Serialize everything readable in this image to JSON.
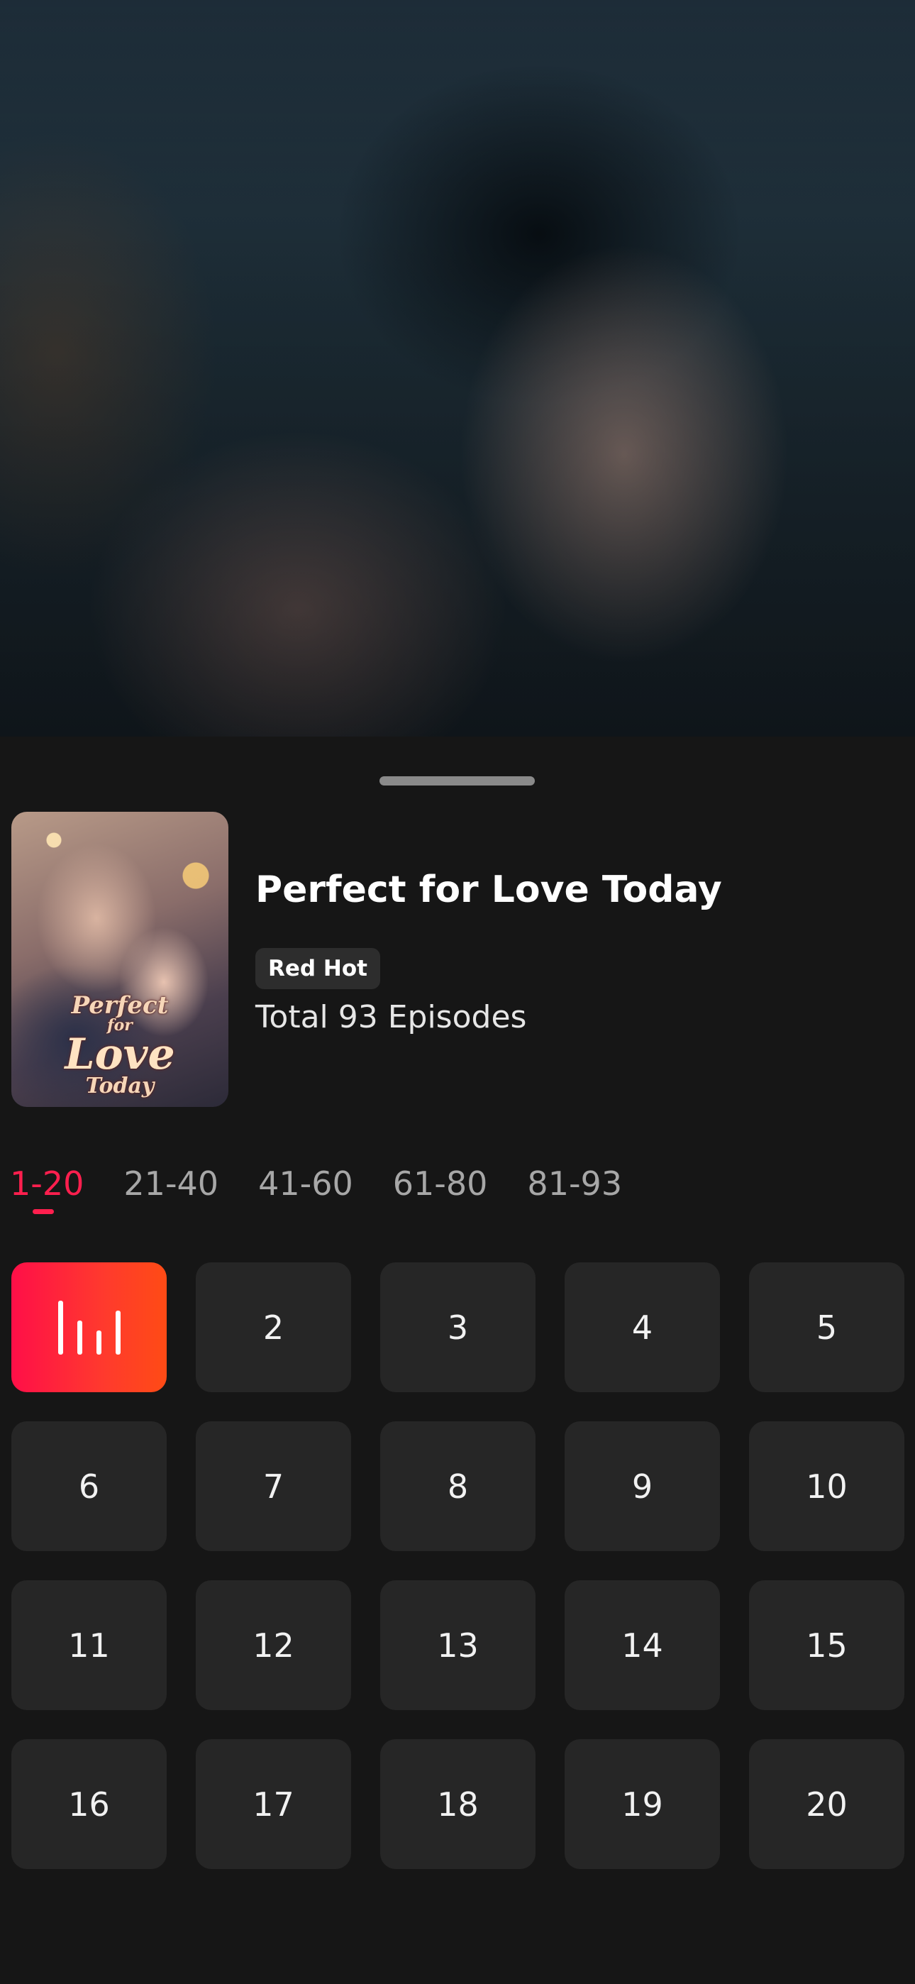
{
  "series": {
    "title": "Perfect for Love Today",
    "badge": "Red Hot",
    "total_episodes_text": "Total 93 Episodes",
    "poster_title_lines": [
      "Perfect",
      "for",
      "Love",
      "Today"
    ]
  },
  "ranges": [
    {
      "label": "1-20",
      "active": true
    },
    {
      "label": "21-40",
      "active": false
    },
    {
      "label": "41-60",
      "active": false
    },
    {
      "label": "61-80",
      "active": false
    },
    {
      "label": "81-93",
      "active": false
    }
  ],
  "episodes": [
    "1",
    "2",
    "3",
    "4",
    "5",
    "6",
    "7",
    "8",
    "9",
    "10",
    "11",
    "12",
    "13",
    "14",
    "15",
    "16",
    "17",
    "18",
    "19",
    "20"
  ],
  "current_episode": "1",
  "icons": {
    "current_episode": "playing-bars-icon",
    "sheet_handle": "drag-handle"
  },
  "colors": {
    "accent": "#ff1f4e",
    "current_gradient_start": "#ff0f48",
    "current_gradient_end": "#ff4b15",
    "tile": "#262626",
    "background": "#161616"
  }
}
